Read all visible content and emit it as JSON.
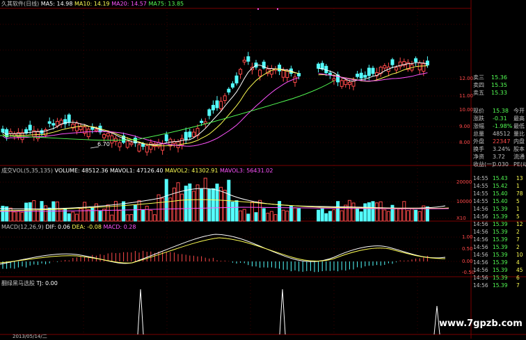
{
  "colors": {
    "up": "#ff4a4a",
    "down": "#54ffff",
    "ma5": "#ffffff",
    "ma10": "#ffff54",
    "ma20": "#ff54ff",
    "ma75": "#54ff54",
    "grid": "#7a0000",
    "label": "#c0c0c0",
    "green": "#54ff54",
    "yellow": "#ffff54",
    "magenta": "#ff54ff",
    "red": "#ff4a4a",
    "cyan": "#54ffff"
  },
  "header": {
    "title": "久其软件(日线)",
    "ma5": "MA5: 14.98",
    "ma10": "MA10: 14.19",
    "ma20": "MA20: 14.57",
    "ma75": "MA75: 13.85"
  },
  "volume_header": {
    "label": "成交VOL(5,35,135)",
    "volume": "VOLUME: 48512.36",
    "mavol1": "MAVOL1: 47126.40",
    "mavol2": "MAVOL2: 41302.91",
    "mavol3": "MAVOL3: 56431.02"
  },
  "macd_header": {
    "label": "MACD(12,26,9)",
    "dif": "DIF: 0.06",
    "dea": "DEA: -0.08",
    "macd": "MACD: 0.28"
  },
  "ind_header": {
    "label": "翻绿黑马选股",
    "tj": "TJ: 0.00"
  },
  "low_marker": "6.70",
  "bottom_date": "2013/05/14/二",
  "price_axis": [
    "12.00",
    "11.00",
    "10.00",
    "9.00",
    "8.00"
  ],
  "volume_axis": [
    "20000",
    "10000",
    "X10"
  ],
  "macd_axis": [
    "1.00",
    "0.50",
    "0.00",
    "-0.50"
  ],
  "order_book": [
    {
      "label": "卖三",
      "price": "15.36",
      "vol": ""
    },
    {
      "label": "卖四",
      "price": "15.35",
      "vol": ""
    },
    {
      "label": "卖五",
      "price": "15.33",
      "vol": ""
    }
  ],
  "quote": [
    {
      "label": "现价",
      "value": "15.38",
      "label2": "今开"
    },
    {
      "label": "涨跌",
      "value": "-0.31",
      "label2": "最高"
    },
    {
      "label": "涨幅",
      "value": "-1.98%",
      "label2": "最低"
    },
    {
      "label": "总量",
      "value": "48512",
      "label2": "量比"
    },
    {
      "label": "外盘",
      "value": "22347",
      "label2": "内盘"
    },
    {
      "label": "换手",
      "value": "3.24%",
      "label2": "股本"
    },
    {
      "label": "净资",
      "value": "3.72",
      "label2": "流通"
    },
    {
      "label": "收益(一)",
      "value": "0.030",
      "label2": "PE(动)"
    }
  ],
  "ticks": [
    {
      "time": "14:55",
      "price": "15.43",
      "vol": "13"
    },
    {
      "time": "14:55",
      "price": "15.42",
      "vol": "1"
    },
    {
      "time": "14:55",
      "price": "15.40",
      "vol": "78"
    },
    {
      "time": "14:55",
      "price": "15.40",
      "vol": "5"
    },
    {
      "time": "14:56",
      "price": "15.39",
      "vol": "1"
    },
    {
      "time": "14:56",
      "price": "15.39",
      "vol": "5"
    },
    {
      "time": "14:56",
      "price": "15.39",
      "vol": "12"
    },
    {
      "time": "14:56",
      "price": "15.39",
      "vol": "2"
    },
    {
      "time": "14:56",
      "price": "15.39",
      "vol": "7"
    },
    {
      "time": "14:56",
      "price": "15.39",
      "vol": "2"
    },
    {
      "time": "14:56",
      "price": "15.39",
      "vol": "10"
    },
    {
      "time": "14:56",
      "price": "15.39",
      "vol": "4"
    },
    {
      "time": "14:56",
      "price": "15.39",
      "vol": "45"
    },
    {
      "time": "14:56",
      "price": "15.39",
      "vol": "6"
    },
    {
      "time": "14:56",
      "price": "15.39",
      "vol": "7"
    }
  ],
  "watermark": "www.7gpzb.com"
}
